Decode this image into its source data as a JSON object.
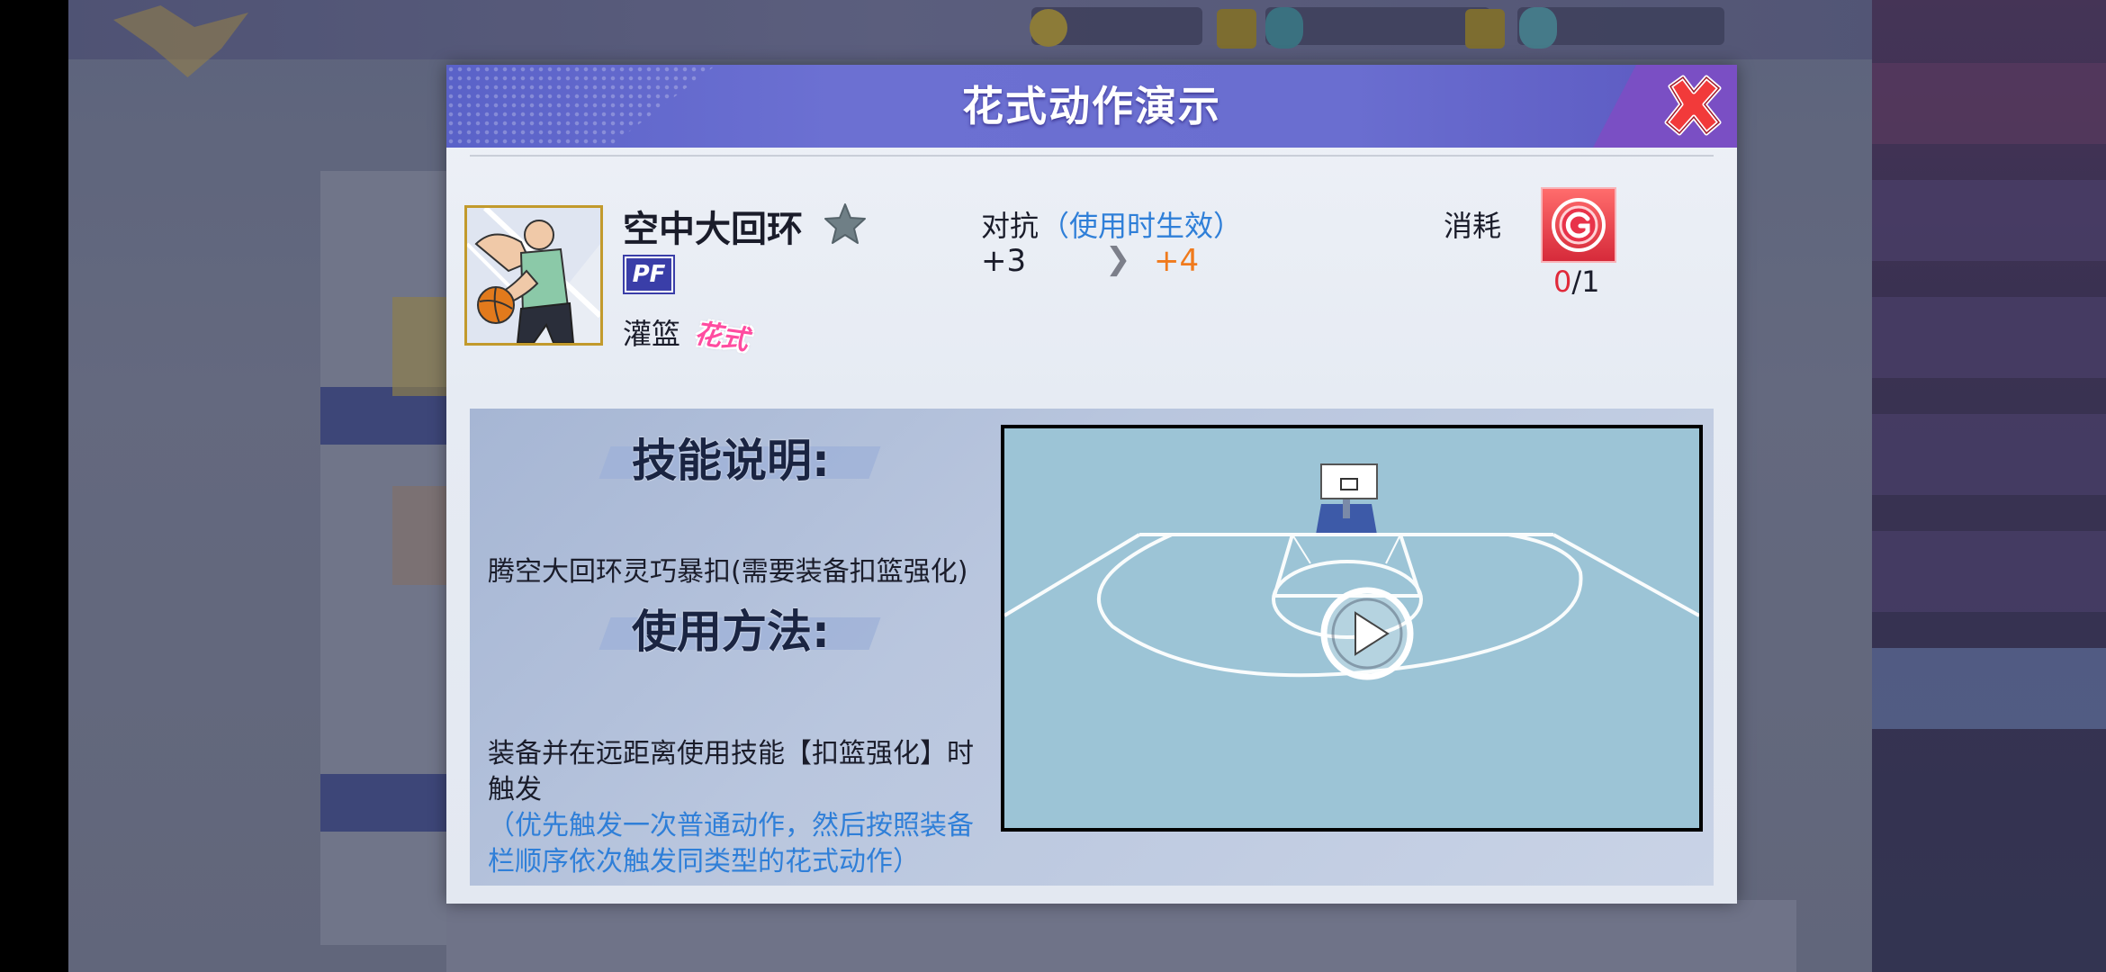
{
  "dialog": {
    "title": "花式动作演示",
    "close_icon": "close-icon"
  },
  "skill": {
    "name": "空中大回环",
    "position": "PF",
    "type": "灌篮",
    "tag": "花式",
    "icon": "player-dunk-portrait"
  },
  "attribute": {
    "label": "对抗",
    "note": "（使用时生效）",
    "current": "+3",
    "arrow": "❯",
    "next": "+4"
  },
  "cost": {
    "label": "消耗",
    "have": "0",
    "separator": "/",
    "need": "1",
    "icon": "fancy-coin-icon"
  },
  "description": {
    "heading": "技能说明:",
    "text": "腾空大回环灵巧暴扣(需要装备扣篮强化)"
  },
  "usage": {
    "heading": "使用方法:",
    "text": "装备并在远距离使用技能【扣篮强化】时触发",
    "note": "（优先触发一次普通动作，然后按照装备栏顺序依次触发同类型的花式动作）"
  },
  "video": {
    "play_icon": "play-icon"
  },
  "colors": {
    "header": "#6a6ed0",
    "accent_blue": "#2f7fd8",
    "accent_orange": "#f07a1c",
    "accent_red": "#e02a3a"
  }
}
